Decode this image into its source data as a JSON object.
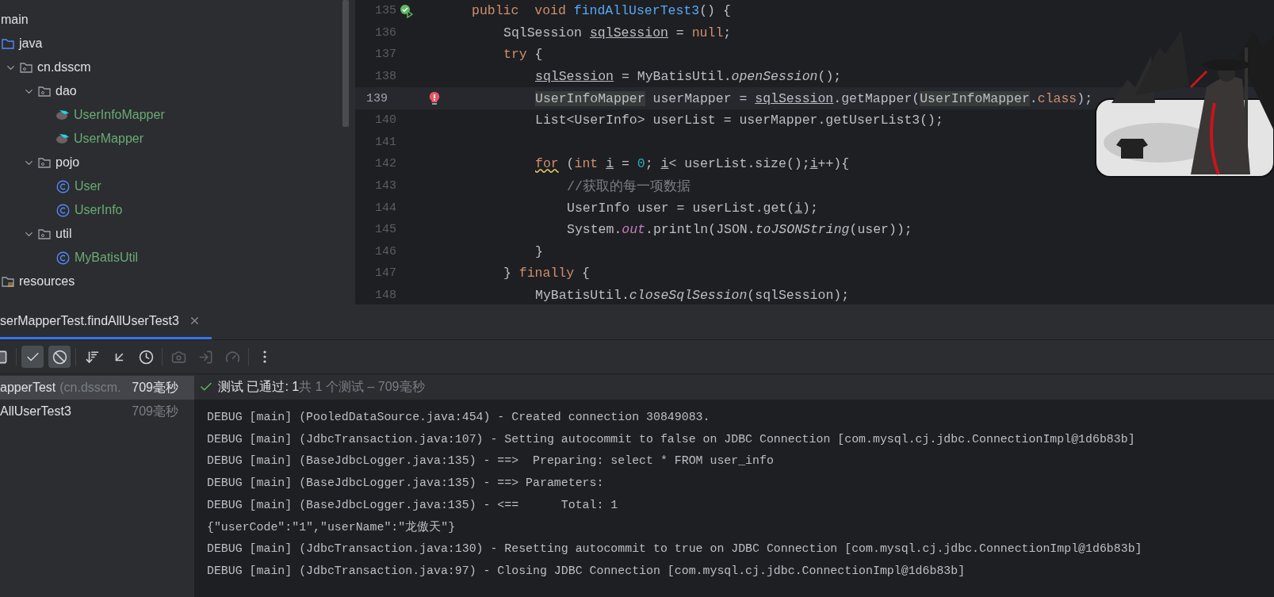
{
  "project_tree": {
    "items": [
      {
        "label": "main",
        "children": [
          {
            "label": "java",
            "kind": "source-folder",
            "children": [
              {
                "label": "cn.dsscm",
                "kind": "package",
                "expanded": true,
                "children": [
                  {
                    "label": "dao",
                    "kind": "package",
                    "expanded": true,
                    "children": [
                      {
                        "label": "UserInfoMapper",
                        "kind": "mapper",
                        "color": "#6aab73"
                      },
                      {
                        "label": "UserMapper",
                        "kind": "mapper",
                        "color": "#6aab73"
                      }
                    ]
                  },
                  {
                    "label": "pojo",
                    "kind": "package",
                    "expanded": true,
                    "children": [
                      {
                        "label": "User",
                        "kind": "class",
                        "color": "#6aab73"
                      },
                      {
                        "label": "UserInfo",
                        "kind": "class",
                        "color": "#6aab73"
                      }
                    ]
                  },
                  {
                    "label": "util",
                    "kind": "package",
                    "expanded": true,
                    "children": [
                      {
                        "label": "MyBatisUtil",
                        "kind": "class",
                        "color": "#6aab73"
                      }
                    ]
                  }
                ]
              }
            ]
          },
          {
            "label": "resources",
            "kind": "resources"
          }
        ]
      }
    ]
  },
  "editor": {
    "lines": [
      {
        "number": "135",
        "kind": "run-passed",
        "current": false,
        "tokens": [
          {
            "text": "public",
            "kind": "keyword"
          },
          {
            "text": "  void",
            "kind": "keyword"
          },
          {
            "text": " findAllUserTest3",
            "kind": "method"
          },
          {
            "text": "() {",
            "kind": "plain"
          }
        ],
        "children": [
          {
            "number": "136",
            "current": false,
            "tokens": [
              {
                "text": "SqlSession ",
                "kind": "plain"
              },
              {
                "text": "sqlSession",
                "kind": "underlined"
              },
              {
                "text": " = ",
                "kind": "plain"
              },
              {
                "text": "null",
                "kind": "keyword"
              },
              {
                "text": ";",
                "kind": "plain"
              }
            ]
          },
          {
            "number": "137",
            "current": false,
            "tokens": [
              {
                "text": "try",
                "kind": "keyword"
              },
              {
                "text": " {",
                "kind": "plain"
              }
            ],
            "children": [
              {
                "number": "138",
                "current": false,
                "tokens": [
                  {
                    "text": "sqlSession",
                    "kind": "underlined"
                  },
                  {
                    "text": " = MyBatisUtil.",
                    "kind": "plain"
                  },
                  {
                    "text": "openSession",
                    "kind": "italic"
                  },
                  {
                    "text": "();",
                    "kind": "plain"
                  }
                ]
              },
              {
                "number": "139",
                "kind": "error-bulb",
                "current": true,
                "tokens": [
                  {
                    "text": "UserInfoMapper",
                    "kind": "highlighted"
                  },
                  {
                    "text": " userMapper = ",
                    "kind": "plain"
                  },
                  {
                    "text": "sqlSession",
                    "kind": "underlined"
                  },
                  {
                    "text": ".getMapper(",
                    "kind": "plain"
                  },
                  {
                    "text": "UserInfoMapper",
                    "kind": "highlighted"
                  },
                  {
                    "text": ".",
                    "kind": "plain"
                  },
                  {
                    "text": "class",
                    "kind": "keyword"
                  },
                  {
                    "text": ");",
                    "kind": "plain"
                  }
                ]
              },
              {
                "number": "140",
                "current": false,
                "tokens": [
                  {
                    "text": "List<UserInfo> userList = userMapper.getUserList3();",
                    "kind": "plain"
                  }
                ]
              },
              {
                "number": "141",
                "current": false
              },
              {
                "number": "142",
                "current": false,
                "tokens": [
                  {
                    "text": "for",
                    "kind": "warning"
                  },
                  {
                    "text": " (",
                    "kind": "plain"
                  },
                  {
                    "text": "int ",
                    "kind": "keyword"
                  },
                  {
                    "text": "i",
                    "kind": "underlined"
                  },
                  {
                    "text": " = ",
                    "kind": "plain"
                  },
                  {
                    "text": "0",
                    "kind": "number"
                  },
                  {
                    "text": "; ",
                    "kind": "plain"
                  },
                  {
                    "text": "i",
                    "kind": "underlined"
                  },
                  {
                    "text": "< userList.size();",
                    "kind": "plain"
                  },
                  {
                    "text": "i",
                    "kind": "underlined"
                  },
                  {
                    "text": "++){",
                    "kind": "plain"
                  }
                ],
                "children": [
                  {
                    "number": "143",
                    "current": false,
                    "tokens": [
                      {
                        "text": "//获取的每一项数据",
                        "kind": "comment"
                      }
                    ]
                  },
                  {
                    "number": "144",
                    "current": false,
                    "tokens": [
                      {
                        "text": "UserInfo user = userList.get(",
                        "kind": "plain"
                      },
                      {
                        "text": "i",
                        "kind": "underlined"
                      },
                      {
                        "text": ");",
                        "kind": "plain"
                      }
                    ]
                  },
                  {
                    "number": "145",
                    "current": false,
                    "tokens": [
                      {
                        "text": "System.",
                        "kind": "plain"
                      },
                      {
                        "text": "out",
                        "kind": "field"
                      },
                      {
                        "text": ".println(JSON.",
                        "kind": "plain"
                      },
                      {
                        "text": "toJSONString",
                        "kind": "italic"
                      },
                      {
                        "text": "(user));",
                        "kind": "plain"
                      }
                    ]
                  }
                ]
              },
              {
                "number": "146",
                "current": false,
                "tokens": [
                  {
                    "text": "}",
                    "kind": "plain"
                  }
                ]
              }
            ]
          },
          {
            "number": "147",
            "current": false,
            "tokens": [
              {
                "text": "} ",
                "kind": "plain"
              },
              {
                "text": "finally",
                "kind": "keyword"
              },
              {
                "text": " {",
                "kind": "plain"
              }
            ],
            "children": [
              {
                "number": "148",
                "current": false,
                "tokens": [
                  {
                    "text": "MyBatisUtil.",
                    "kind": "plain"
                  },
                  {
                    "text": "closeSqlSession",
                    "kind": "italic"
                  },
                  {
                    "text": "(sqlSession);",
                    "kind": "plain"
                  }
                ]
              }
            ]
          }
        ]
      }
    ]
  },
  "run_panel": {
    "tabs": [
      {
        "label": "serMapperTest.findAllUserTest3",
        "selected": true
      }
    ],
    "toolbar": [
      {
        "kind": "stop",
        "on": false,
        "disabled": false
      },
      {
        "kind": "passed",
        "on": true,
        "disabled": false
      },
      {
        "kind": "ignored",
        "on": true,
        "disabled": false
      },
      {
        "kind": "sort",
        "on": false,
        "disabled": false
      },
      {
        "kind": "collapse",
        "on": false,
        "disabled": false
      },
      {
        "kind": "history",
        "on": false,
        "disabled": false
      },
      {
        "kind": "snapshot",
        "on": false,
        "disabled": true
      },
      {
        "kind": "import",
        "on": false,
        "disabled": true
      },
      {
        "kind": "coverage",
        "on": false,
        "disabled": true
      },
      {
        "kind": "more",
        "on": false,
        "disabled": false
      }
    ],
    "tests": [
      {
        "name": "apperTest",
        "detail": "(cn.dsscm.",
        "time": "709毫秒",
        "selected": true
      },
      {
        "name": "AllUserTest3",
        "time": "709毫秒",
        "selected": false
      }
    ],
    "status": {
      "passed": "测试 已通过: 1",
      "summary": "共 1 个测试 – 709毫秒"
    },
    "console": [
      "DEBUG [main] (PooledDataSource.java:454) - Created connection 30849083.",
      "DEBUG [main] (JdbcTransaction.java:107) - Setting autocommit to false on JDBC Connection [com.mysql.cj.jdbc.ConnectionImpl@1d6b83b]",
      "DEBUG [main] (BaseJdbcLogger.java:135) - ==>  Preparing: select * FROM user_info",
      "DEBUG [main] (BaseJdbcLogger.java:135) - ==> Parameters:",
      "DEBUG [main] (BaseJdbcLogger.java:135) - <==      Total: 1",
      "{\"userCode\":\"1\",\"userName\":\"龙傲天\"}",
      "DEBUG [main] (JdbcTransaction.java:130) - Resetting autocommit to true on JDBC Connection [com.mysql.cj.jdbc.ConnectionImpl@1d6b83b]",
      "DEBUG [main] (JdbcTransaction.java:97) - Closing JDBC Connection [com.mysql.cj.jdbc.ConnectionImpl@1d6b83b]"
    ]
  }
}
